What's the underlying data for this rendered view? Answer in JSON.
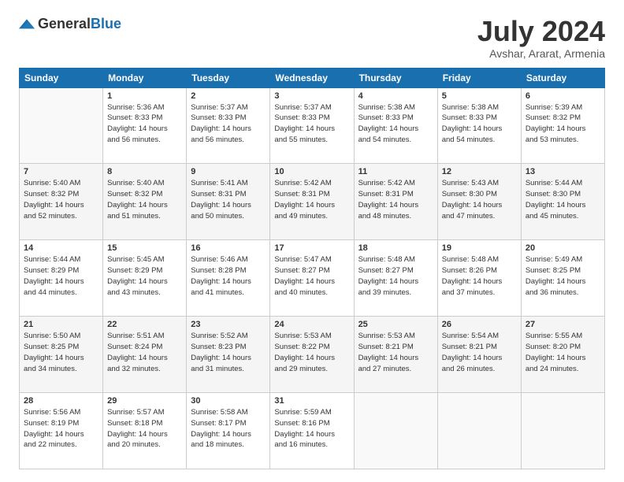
{
  "header": {
    "logo_general": "General",
    "logo_blue": "Blue",
    "month": "July 2024",
    "location": "Avshar, Ararat, Armenia"
  },
  "weekdays": [
    "Sunday",
    "Monday",
    "Tuesday",
    "Wednesday",
    "Thursday",
    "Friday",
    "Saturday"
  ],
  "weeks": [
    [
      {
        "day": "",
        "info": ""
      },
      {
        "day": "1",
        "info": "Sunrise: 5:36 AM\nSunset: 8:33 PM\nDaylight: 14 hours\nand 56 minutes."
      },
      {
        "day": "2",
        "info": "Sunrise: 5:37 AM\nSunset: 8:33 PM\nDaylight: 14 hours\nand 56 minutes."
      },
      {
        "day": "3",
        "info": "Sunrise: 5:37 AM\nSunset: 8:33 PM\nDaylight: 14 hours\nand 55 minutes."
      },
      {
        "day": "4",
        "info": "Sunrise: 5:38 AM\nSunset: 8:33 PM\nDaylight: 14 hours\nand 54 minutes."
      },
      {
        "day": "5",
        "info": "Sunrise: 5:38 AM\nSunset: 8:33 PM\nDaylight: 14 hours\nand 54 minutes."
      },
      {
        "day": "6",
        "info": "Sunrise: 5:39 AM\nSunset: 8:32 PM\nDaylight: 14 hours\nand 53 minutes."
      }
    ],
    [
      {
        "day": "7",
        "info": "Sunrise: 5:40 AM\nSunset: 8:32 PM\nDaylight: 14 hours\nand 52 minutes."
      },
      {
        "day": "8",
        "info": "Sunrise: 5:40 AM\nSunset: 8:32 PM\nDaylight: 14 hours\nand 51 minutes."
      },
      {
        "day": "9",
        "info": "Sunrise: 5:41 AM\nSunset: 8:31 PM\nDaylight: 14 hours\nand 50 minutes."
      },
      {
        "day": "10",
        "info": "Sunrise: 5:42 AM\nSunset: 8:31 PM\nDaylight: 14 hours\nand 49 minutes."
      },
      {
        "day": "11",
        "info": "Sunrise: 5:42 AM\nSunset: 8:31 PM\nDaylight: 14 hours\nand 48 minutes."
      },
      {
        "day": "12",
        "info": "Sunrise: 5:43 AM\nSunset: 8:30 PM\nDaylight: 14 hours\nand 47 minutes."
      },
      {
        "day": "13",
        "info": "Sunrise: 5:44 AM\nSunset: 8:30 PM\nDaylight: 14 hours\nand 45 minutes."
      }
    ],
    [
      {
        "day": "14",
        "info": "Sunrise: 5:44 AM\nSunset: 8:29 PM\nDaylight: 14 hours\nand 44 minutes."
      },
      {
        "day": "15",
        "info": "Sunrise: 5:45 AM\nSunset: 8:29 PM\nDaylight: 14 hours\nand 43 minutes."
      },
      {
        "day": "16",
        "info": "Sunrise: 5:46 AM\nSunset: 8:28 PM\nDaylight: 14 hours\nand 41 minutes."
      },
      {
        "day": "17",
        "info": "Sunrise: 5:47 AM\nSunset: 8:27 PM\nDaylight: 14 hours\nand 40 minutes."
      },
      {
        "day": "18",
        "info": "Sunrise: 5:48 AM\nSunset: 8:27 PM\nDaylight: 14 hours\nand 39 minutes."
      },
      {
        "day": "19",
        "info": "Sunrise: 5:48 AM\nSunset: 8:26 PM\nDaylight: 14 hours\nand 37 minutes."
      },
      {
        "day": "20",
        "info": "Sunrise: 5:49 AM\nSunset: 8:25 PM\nDaylight: 14 hours\nand 36 minutes."
      }
    ],
    [
      {
        "day": "21",
        "info": "Sunrise: 5:50 AM\nSunset: 8:25 PM\nDaylight: 14 hours\nand 34 minutes."
      },
      {
        "day": "22",
        "info": "Sunrise: 5:51 AM\nSunset: 8:24 PM\nDaylight: 14 hours\nand 32 minutes."
      },
      {
        "day": "23",
        "info": "Sunrise: 5:52 AM\nSunset: 8:23 PM\nDaylight: 14 hours\nand 31 minutes."
      },
      {
        "day": "24",
        "info": "Sunrise: 5:53 AM\nSunset: 8:22 PM\nDaylight: 14 hours\nand 29 minutes."
      },
      {
        "day": "25",
        "info": "Sunrise: 5:53 AM\nSunset: 8:21 PM\nDaylight: 14 hours\nand 27 minutes."
      },
      {
        "day": "26",
        "info": "Sunrise: 5:54 AM\nSunset: 8:21 PM\nDaylight: 14 hours\nand 26 minutes."
      },
      {
        "day": "27",
        "info": "Sunrise: 5:55 AM\nSunset: 8:20 PM\nDaylight: 14 hours\nand 24 minutes."
      }
    ],
    [
      {
        "day": "28",
        "info": "Sunrise: 5:56 AM\nSunset: 8:19 PM\nDaylight: 14 hours\nand 22 minutes."
      },
      {
        "day": "29",
        "info": "Sunrise: 5:57 AM\nSunset: 8:18 PM\nDaylight: 14 hours\nand 20 minutes."
      },
      {
        "day": "30",
        "info": "Sunrise: 5:58 AM\nSunset: 8:17 PM\nDaylight: 14 hours\nand 18 minutes."
      },
      {
        "day": "31",
        "info": "Sunrise: 5:59 AM\nSunset: 8:16 PM\nDaylight: 14 hours\nand 16 minutes."
      },
      {
        "day": "",
        "info": ""
      },
      {
        "day": "",
        "info": ""
      },
      {
        "day": "",
        "info": ""
      }
    ]
  ]
}
